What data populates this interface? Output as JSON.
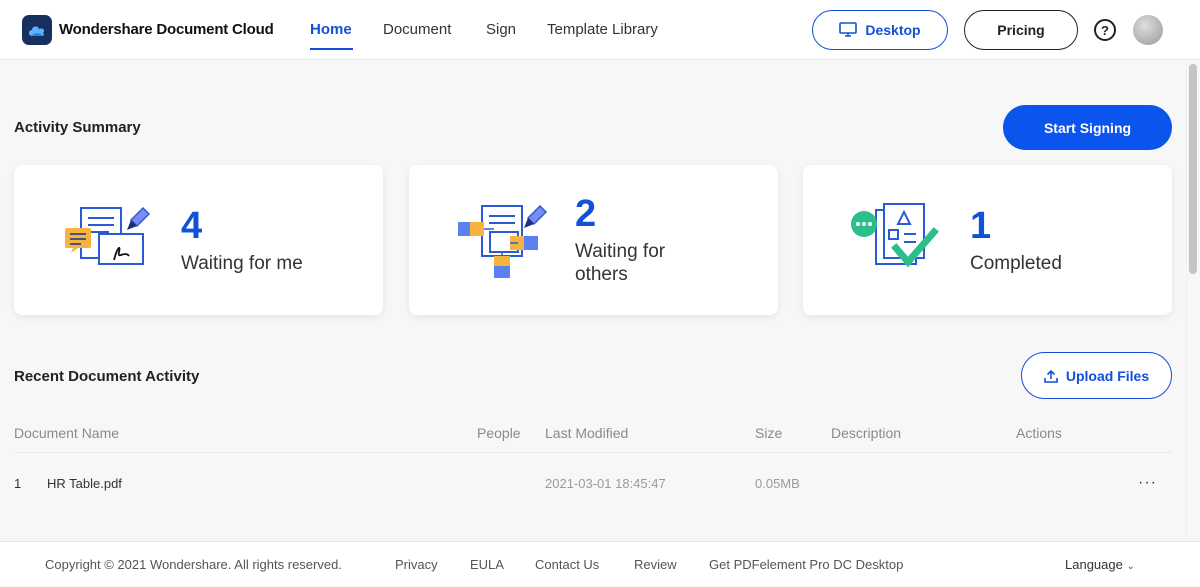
{
  "header": {
    "brand": "Wondershare Document Cloud",
    "nav": [
      "Home",
      "Document",
      "Sign",
      "Template Library"
    ],
    "active_nav": "Home",
    "desktop_label": "Desktop",
    "pricing_label": "Pricing",
    "help_glyph": "?"
  },
  "activity": {
    "title": "Activity Summary",
    "start_label": "Start Signing",
    "cards": [
      {
        "count": "4",
        "label": "Waiting for me"
      },
      {
        "count": "2",
        "label": "Waiting for others"
      },
      {
        "count": "1",
        "label": "Completed"
      }
    ]
  },
  "recent": {
    "title": "Recent Document Activity",
    "upload_label": "Upload Files",
    "columns": [
      "Document Name",
      "People",
      "Last Modified",
      "Size",
      "Description",
      "Actions"
    ],
    "rows": [
      {
        "index": "1",
        "name": "HR Table.pdf",
        "modified": "2021-03-01 18:45:47",
        "size": "0.05MB",
        "actions": "···"
      }
    ]
  },
  "footer": {
    "copyright": "Copyright © 2021 Wondershare. All rights reserved.",
    "links": [
      "Privacy",
      "EULA",
      "Contact Us",
      "Review",
      "Get PDFelement Pro DC Desktop"
    ],
    "language": "Language"
  },
  "colors": {
    "accent": "#1150d8",
    "primary_button": "#0b55ee",
    "success": "#2bbf8a",
    "note": "#f4b43f"
  }
}
